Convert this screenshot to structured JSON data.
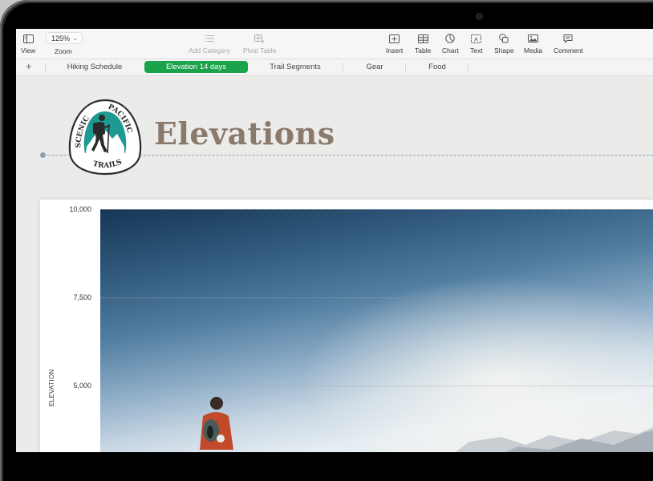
{
  "toolbar": {
    "view_label": "View",
    "zoom_value": "125%",
    "zoom_label": "Zoom",
    "add_category_label": "Add Category",
    "pivot_table_label": "Pivot Table",
    "insert_label": "Insert",
    "table_label": "Table",
    "chart_label": "Chart",
    "text_label": "Text",
    "shape_label": "Shape",
    "media_label": "Media",
    "comment_label": "Comment"
  },
  "sheets": {
    "add_icon": "+",
    "tabs": [
      {
        "label": "Hiking Schedule",
        "active": false
      },
      {
        "label": "Elevation 14 days",
        "active": true
      },
      {
        "label": "Trail Segments",
        "active": false
      },
      {
        "label": "Gear",
        "active": false
      },
      {
        "label": "Food",
        "active": false
      }
    ]
  },
  "document": {
    "title": "Elevations",
    "logo": {
      "top_left_text": "SCENIC",
      "top_right_text": "PACIFIC",
      "bottom_text": "TRAILS"
    },
    "accent_color": "#1aa34a",
    "title_color": "#8a7a6c"
  },
  "chart_data": {
    "type": "bar",
    "ylabel": "ELEVATION",
    "yticks": [
      "10,000",
      "7,500",
      "5,000"
    ],
    "ylim_visible": [
      5000,
      10000
    ],
    "background": "photo of hiker facing mountains under blue sky",
    "grid": true
  }
}
